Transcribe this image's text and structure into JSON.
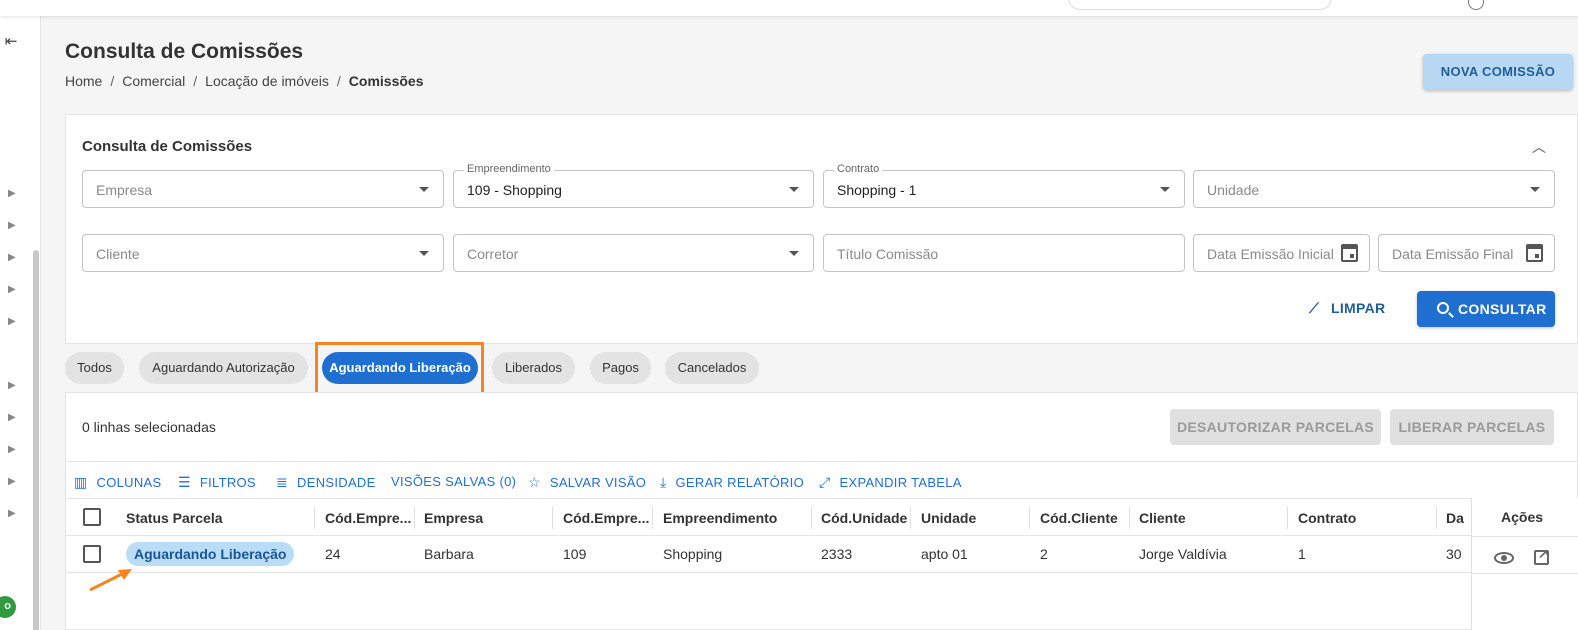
{
  "header": {
    "title": "Consulta de Comissões",
    "breadcrumb": [
      "Home",
      "Comercial",
      "Locação de imóveis",
      "Comissões"
    ],
    "new_button": "NOVA COMISSÃO"
  },
  "sidebar": {
    "badge": "o"
  },
  "filters": {
    "title": "Consulta de Comissões",
    "empresa": {
      "placeholder": "Empresa",
      "value": ""
    },
    "empreendimento": {
      "label": "Empreendimento",
      "value": "109 - Shopping"
    },
    "contrato": {
      "label": "Contrato",
      "value": "Shopping - 1"
    },
    "unidade": {
      "placeholder": "Unidade",
      "value": ""
    },
    "cliente": {
      "placeholder": "Cliente",
      "value": ""
    },
    "corretor": {
      "placeholder": "Corretor",
      "value": ""
    },
    "titulo": {
      "placeholder": "Título Comissão",
      "value": ""
    },
    "data_inicial": {
      "placeholder": "Data Emissão Inicial"
    },
    "data_final": {
      "placeholder": "Data Emissão Final"
    },
    "clear_button": "LIMPAR",
    "search_button": "CONSULTAR"
  },
  "status_tabs": [
    {
      "label": "Todos",
      "active": false
    },
    {
      "label": "Aguardando Autorização",
      "active": false
    },
    {
      "label": "Aguardando Liberação",
      "active": true
    },
    {
      "label": "Liberados",
      "active": false
    },
    {
      "label": "Pagos",
      "active": false
    },
    {
      "label": "Cancelados",
      "active": false
    }
  ],
  "table": {
    "selected_text": "0 linhas selecionadas",
    "unauthorize_button": "DESAUTORIZAR PARCELAS",
    "release_button": "LIBERAR PARCELAS",
    "toolbar": {
      "columns": "COLUNAS",
      "filters": "FILTROS",
      "density": "DENSIDADE",
      "saved_views": "VISÕES SALVAS (0)",
      "save_view": "SALVAR VISÃO",
      "report": "GERAR RELATÓRIO",
      "expand": "EXPANDIR TABELA"
    },
    "columns": [
      "Status Parcela",
      "Cód.Empre...",
      "Empresa",
      "Cód.Empre...",
      "Empreendimento",
      "Cód.Unidade",
      "Unidade",
      "Cód.Cliente",
      "Cliente",
      "Contrato",
      "Da",
      "Ações"
    ],
    "rows": [
      {
        "status": "Aguardando Liberação",
        "cod_empresa": "24",
        "empresa": "Barbara",
        "cod_empreendimento": "109",
        "empreendimento": "Shopping",
        "cod_unidade": "2333",
        "unidade": "apto 01",
        "cod_cliente": "2",
        "cliente": "Jorge Valdívia",
        "contrato": "1",
        "data": "30"
      }
    ]
  },
  "colors": {
    "primary": "#1f6fd1",
    "highlight": "#f5861f",
    "status_pill_bg": "#b9dcf7"
  }
}
